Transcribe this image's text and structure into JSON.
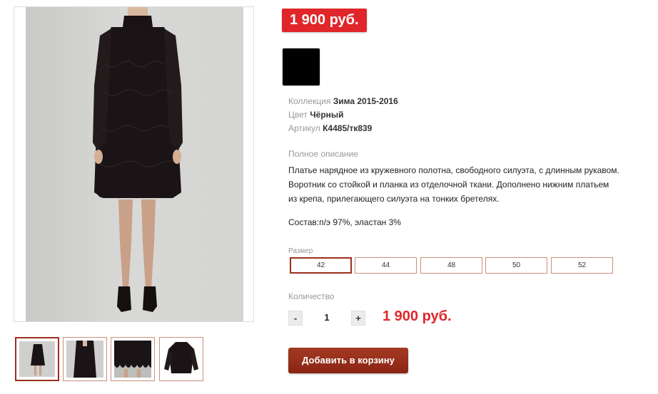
{
  "product": {
    "price_badge": "1 900 руб.",
    "color_swatch_hex": "#000000",
    "specs": [
      {
        "label": "Коллекция",
        "value": "Зима 2015-2016"
      },
      {
        "label": "Цвет",
        "value": "Чёрный"
      },
      {
        "label": "Артикул",
        "value": "К4485/тк839"
      }
    ],
    "description_title": "Полное описание",
    "description_lines": [
      "Платье нарядное из  кружевного полотна, свободного силуэта, с длинным рукавом.",
      "Воротник со стойкой и планка  из отделочной  ткани.  Дополнено нижним платьем",
      "из крепа, прилегающего силуэта на тонких бретелях."
    ],
    "composition": "Состав:п/э 97%, эластан 3%",
    "size_title": "Размер",
    "sizes": [
      "42",
      "44",
      "48",
      "50",
      "52"
    ],
    "selected_size": "42",
    "quantity_title": "Количество",
    "qty_minus": "-",
    "qty_value": "1",
    "qty_plus": "+",
    "total_price": "1 900 руб.",
    "add_to_cart_label": "Добавить в корзину"
  },
  "gallery": {
    "thumbnails": [
      "front-view",
      "close-up-front",
      "close-up-hem",
      "flat-lay"
    ],
    "active_index": 0
  },
  "colors": {
    "accent_red": "#e0262a",
    "button_brown": "#8a2414",
    "selected_border": "#9b2f1d"
  }
}
